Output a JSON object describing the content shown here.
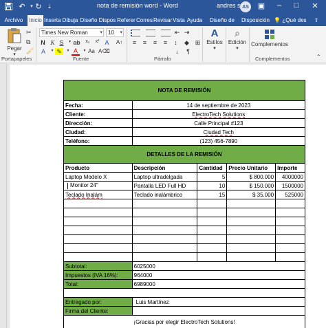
{
  "titlebar": {
    "doc_title": "nota de remisión word",
    "app": "Word",
    "user": "andres soto",
    "initials": "AS",
    "quick_access": [
      "save-icon",
      "undo-icon",
      "redo-icon",
      "customize-icon"
    ]
  },
  "tabs": [
    "Archivo",
    "Inicio",
    "Inserta",
    "Dibuja",
    "Diseño",
    "Dispos",
    "Referer",
    "Corres",
    "Revisar",
    "Vista",
    "Ayuda",
    "Diseño de tabla",
    "Disposición"
  ],
  "help_search": "¿Qué des",
  "ribbon": {
    "paste": "Pegar",
    "font": "Times New Roman",
    "size": "10",
    "styles": "Estilos",
    "edit": "Edición",
    "addins": "Complementos",
    "groups": {
      "clipboard": "Portapapeles",
      "font": "Fuente",
      "paragraph": "Párrafo",
      "addins": "Complementos"
    }
  },
  "doc": {
    "title": "NOTA DE REMISIÓN",
    "info": [
      {
        "label": "Fecha:",
        "value": "14 de septiembre de 2023"
      },
      {
        "label": "Cliente:",
        "value": "ElectroTech Solutions"
      },
      {
        "label": "Dirección:",
        "value": "Calle Principal #123"
      },
      {
        "label": "Ciudad:",
        "value": "Ciudad Tech"
      },
      {
        "label": "Teléfono:",
        "value": "(123) 456-7890"
      }
    ],
    "details_title": "DETALLES DE LA REMISIÓN",
    "headers": [
      "Producto",
      "Descripción",
      "Cantidad",
      "Precio Unitario",
      "Importe"
    ],
    "rows": [
      [
        "Laptop Modelo X",
        "Laptop ultradelgada",
        "5",
        "$ 800.000",
        "4000000"
      ],
      [
        "Monitor 24\"",
        "Pantalla LED Full HD",
        "10",
        "$ 150.000",
        "1500000"
      ],
      [
        "Teclado Inalám",
        "Teclado inalámbrico",
        "15",
        "$ 35.000",
        "525000"
      ]
    ],
    "totals": [
      {
        "label": "Subtotal:",
        "value": "6025000"
      },
      {
        "label": "Impuestos (IVA 16%):",
        "value": "964000"
      },
      {
        "label": "Total:",
        "value": "6989000"
      }
    ],
    "delivered_label": "Entregado por:",
    "delivered_value": "Luis Martínez",
    "signature_label": "Firma del Cliente:",
    "thanks": "¡Gracias por elegir ElectroTech Solutions!"
  }
}
